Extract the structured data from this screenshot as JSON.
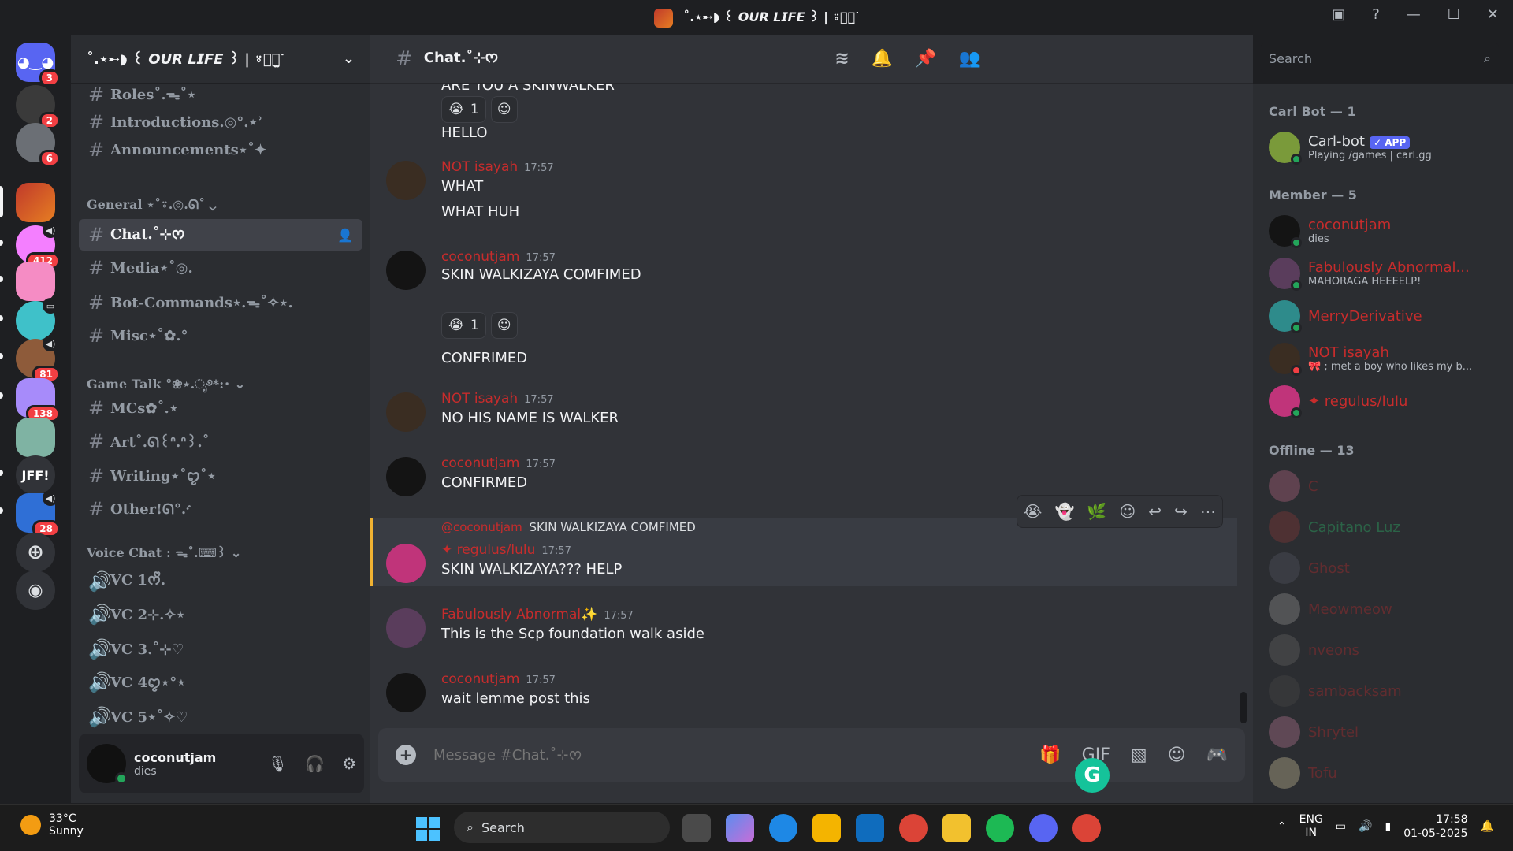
{
  "window": {
    "title": "˚.⋆➸◗ ꒰ 𝙊𝙐𝙍 𝙇𝙄𝙁𝙀 ꒱ | ⍤ིུ̫ᐝ"
  },
  "rail": {
    "servers": [
      {
        "name": "discord-home",
        "badge": "3",
        "color": "#5865f2",
        "letter": ""
      },
      {
        "name": "server-1",
        "badge": "2",
        "color": "#3a3a3a",
        "letter": ""
      },
      {
        "name": "server-2",
        "badge": "6",
        "color": "#6b6f75",
        "letter": ""
      },
      {
        "name": "server-our-life",
        "badge": "",
        "color": "#c0392b",
        "letter": ""
      },
      {
        "name": "server-4",
        "badge": "412",
        "color": "#f47fff",
        "letter": ""
      },
      {
        "name": "server-5",
        "badge": "",
        "color": "#f58cc4",
        "letter": ""
      },
      {
        "name": "server-6",
        "badge": "",
        "color": "#3fc1c9",
        "letter": ""
      },
      {
        "name": "server-7",
        "badge": "81",
        "color": "#8e5b3a",
        "letter": ""
      },
      {
        "name": "server-8",
        "badge": "138",
        "color": "#a78bfa",
        "letter": ""
      },
      {
        "name": "server-9",
        "badge": "",
        "color": "#7fb3a3",
        "letter": ""
      },
      {
        "name": "server-jff",
        "badge": "",
        "color": "#313338",
        "letter": "JFF!"
      },
      {
        "name": "server-11",
        "badge": "28",
        "color": "#2f6fd6",
        "letter": ""
      }
    ]
  },
  "sidebar": {
    "server_name": "˚.⋆➸◗ ꒰ 𝙊𝙐𝙍 𝙇𝙄𝙁𝙀 ꒱ | ⍤ིུ̫ᐝ",
    "channels_top": [
      "Roles˚.ᯓ˚⋆",
      "Introductions.◎°.⋆ʾ",
      "Announcements⋆˚✦"
    ],
    "cat_general": "General ⋆˚⍤.◎.ᘏ˚",
    "general_channels": [
      "Chat.˚⊹ᰔ",
      "Media⋆˚◎.",
      "Bot-Commands⋆.ᯓ˚✧⋆.",
      "Misc⋆˚✿.°"
    ],
    "cat_game": "Game Talk °❀⋆.ೃ࿔*:･",
    "game_channels": [
      "MCs✿˚.⋆",
      "Art˚.ᘏ꒰ᐢ.ᐢ꒱.˚",
      "Writing⋆˚ꨄ˚⋆",
      "Other!ᘏ°.ᐝ"
    ],
    "cat_voice": "Voice Chat : ᯓ˚.⌨︎꒱",
    "voice_channels": [
      "VC 1ᰔᩚ.",
      "VC 2⊹.✧⋆",
      "VC 3.˚⊹♡",
      "VC 4ꨄ⋆°⋆",
      "VC 5⋆˚✧♡"
    ]
  },
  "user_panel": {
    "name": "coconutjam",
    "status": "dies"
  },
  "header": {
    "channel": "Chat.˚⊹ᰔ",
    "search_placeholder": "Search"
  },
  "messages": {
    "cut_top": "ARE YOU A SKINWALKER",
    "r1_count": "1",
    "m1_cont": "HELLO",
    "m2": {
      "author": "NOT isayah",
      "time": "17:57",
      "lines": [
        "WHAT",
        "WHAT HUH"
      ]
    },
    "m3": {
      "author": "coconutjam",
      "time": "17:57",
      "text": "SKIN WALKIZAYA COMFIMED",
      "react_count": "1",
      "cont": "CONFRIMED"
    },
    "m4": {
      "author": "NOT isayah",
      "time": "17:57",
      "text": "NO HIS NAME IS WALKER"
    },
    "m5": {
      "author": "coconutjam",
      "time": "17:57",
      "text": "CONFIRMED"
    },
    "m6": {
      "reply_to": "@coconutjam",
      "reply_text": "SKIN WALKIZAYA COMFIMED",
      "author": "✦ regulus/lulu",
      "time": "17:57",
      "text": "SKIN WALKIZAYA??? HELP"
    },
    "m7": {
      "author": "Fabulously Abnormal✨",
      "time": "17:57",
      "text": "This is the Scp foundation walk aside"
    },
    "m8": {
      "author": "coconutjam",
      "time": "17:57",
      "text": "wait lemme post this"
    }
  },
  "composer": {
    "placeholder": "Message #Chat.˚⊹ᰔ"
  },
  "members": {
    "carl_group": "Carl Bot — 1",
    "carl": {
      "name": "Carl-bot",
      "badge": "✓ APP",
      "status": "Playing /games | carl.gg"
    },
    "member_group": "Member — 5",
    "online": [
      {
        "name": "coconutjam",
        "status": "dies"
      },
      {
        "name": "Fabulously Abnormal...",
        "status": "MAHORAGA HEEEELP!"
      },
      {
        "name": "MerryDerivative",
        "status": ""
      },
      {
        "name": "NOT isayah",
        "status": "🎀 ; met a boy who likes my b..."
      },
      {
        "name": "✦ regulus/lulu",
        "status": ""
      }
    ],
    "offline_group": "Offline — 13",
    "offline": [
      "C",
      "Capitano Luz",
      "Ghost",
      "Meowmeow",
      "nveons",
      "sambacksam",
      "Shrytel",
      "Tofu"
    ]
  },
  "taskbar": {
    "temp": "33°C",
    "weather": "Sunny",
    "search": "Search",
    "lang1": "ENG",
    "lang2": "IN",
    "time": "17:58",
    "date": "01-05-2025"
  },
  "colors": {
    "accent": "#5865f2",
    "name_red": "#c72c2c",
    "online": "#23a55a",
    "highlight_bar": "#f0b232"
  }
}
